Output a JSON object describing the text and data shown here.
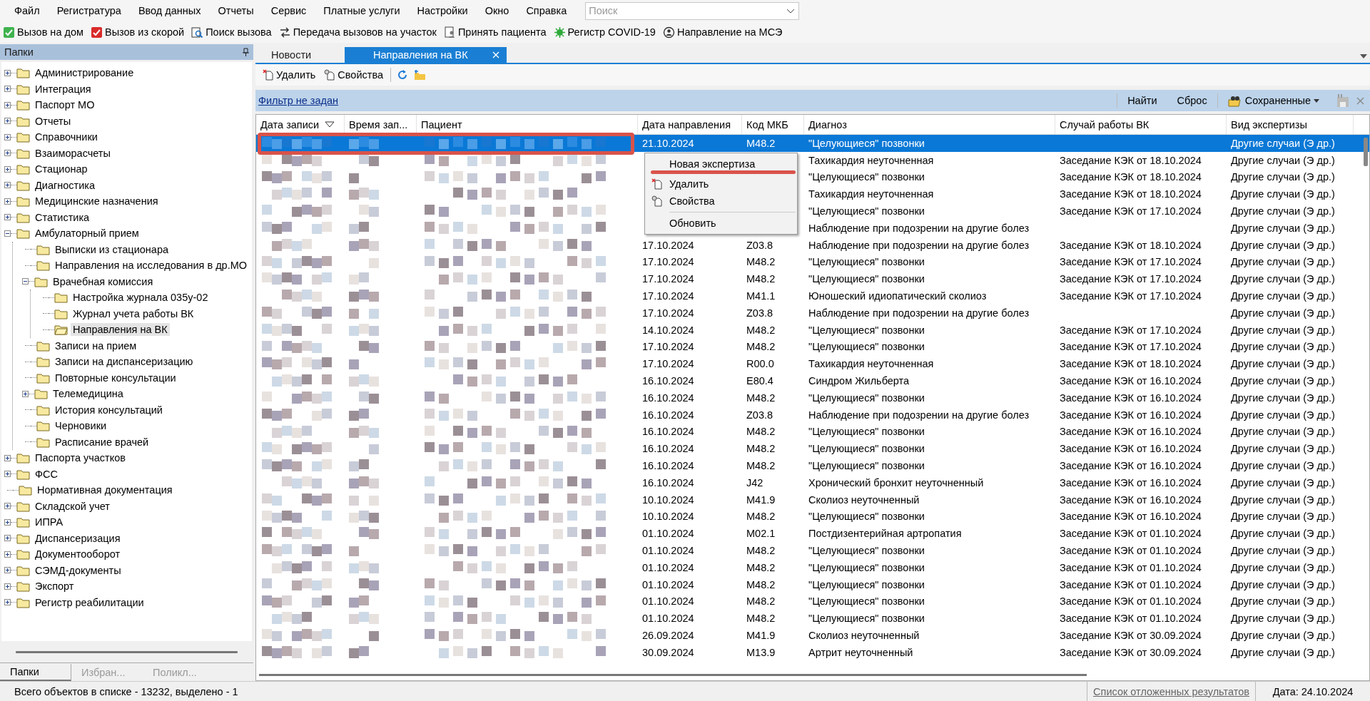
{
  "menu_bar": {
    "items": [
      "Файл",
      "Регистратура",
      "Ввод данных",
      "Отчеты",
      "Сервис",
      "Платные услуги",
      "Настройки",
      "Окно",
      "Справка"
    ],
    "search": {
      "placeholder": "Поиск"
    }
  },
  "toolbar": [
    "Вызов на дом",
    "Вызов из скорой",
    "Поиск вызова",
    "Передача вызовов на участок",
    "Принять пациента",
    "Регистр COVID-19",
    "Направление на МСЭ"
  ],
  "sidebar": {
    "title": "Папки",
    "tree": [
      {
        "label": "Администрирование",
        "expanded": false,
        "selected": false
      },
      {
        "label": "Интеграция",
        "expanded": false,
        "selected": false
      },
      {
        "label": "Паспорт МО",
        "expanded": false,
        "selected": false
      },
      {
        "label": "Отчеты",
        "expanded": false,
        "selected": false
      },
      {
        "label": "Справочники",
        "expanded": false,
        "selected": false
      },
      {
        "label": "Взаиморасчеты",
        "expanded": false,
        "selected": false
      },
      {
        "label": "Стационар",
        "expanded": false,
        "selected": false
      },
      {
        "label": "Диагностика",
        "expanded": false,
        "selected": false
      },
      {
        "label": "Медицинские назначения",
        "expanded": false,
        "selected": false
      },
      {
        "label": "Статистика",
        "expanded": false,
        "selected": false
      },
      {
        "label": "Амбулаторный прием",
        "expanded": true,
        "selected": false,
        "children": [
          {
            "label": "Выписки из стационара",
            "selected": false
          },
          {
            "label": "Направления на исследования в др.МО",
            "selected": false
          },
          {
            "label": "Врачебная комиссия",
            "expanded": true,
            "selected": false,
            "children": [
              {
                "label": "Настройка журнала 035у-02",
                "selected": false
              },
              {
                "label": "Журнал учета работы ВК",
                "selected": false
              },
              {
                "label": "Направления на ВК",
                "selected": true
              }
            ]
          },
          {
            "label": "Записи на прием",
            "selected": false
          },
          {
            "label": "Записи на диспансеризацию",
            "selected": false
          },
          {
            "label": "Повторные консультации",
            "selected": false
          },
          {
            "label": "Телемедицина",
            "expanded": false,
            "selected": false
          },
          {
            "label": "История консультаций",
            "selected": false
          },
          {
            "label": "Черновики",
            "selected": false
          },
          {
            "label": "Расписание врачей",
            "selected": false
          }
        ]
      },
      {
        "label": "Паспорта участков",
        "expanded": false,
        "selected": false
      },
      {
        "label": "ФСС",
        "expanded": false,
        "selected": false
      },
      {
        "label": "Нормативная документация",
        "selected": false
      },
      {
        "label": "Складской учет",
        "expanded": false,
        "selected": false
      },
      {
        "label": "ИПРА",
        "expanded": false,
        "selected": false
      },
      {
        "label": "Диспансеризация",
        "expanded": false,
        "selected": false
      },
      {
        "label": "Документооборот",
        "expanded": false,
        "selected": false
      },
      {
        "label": "СЭМД-документы",
        "expanded": false,
        "selected": false
      },
      {
        "label": "Экспорт",
        "expanded": false,
        "selected": false
      },
      {
        "label": "Регистр реабилитации",
        "expanded": false,
        "selected": false
      }
    ],
    "tabs": [
      {
        "label": "Папки",
        "selected": true
      },
      {
        "label": "Избран...",
        "selected": false
      },
      {
        "label": "Поликл...",
        "selected": false
      }
    ]
  },
  "tabs": [
    {
      "label": "Новости",
      "selected": false
    },
    {
      "label": "Направления на ВК",
      "selected": true
    }
  ],
  "doc_toolbar": [
    "Удалить",
    "Свойства"
  ],
  "filter": {
    "link": "Фильтр не задан",
    "buttons": [
      "Найти",
      "Сброс"
    ],
    "saved": "Сохраненные"
  },
  "table": {
    "columns": [
      {
        "label": "Дата записи",
        "sorted": true
      },
      {
        "label": "Время зап...",
        "sorted": false
      },
      {
        "label": "Пациент",
        "sorted": false
      },
      {
        "label": "Дата направления",
        "sorted": false
      },
      {
        "label": "Код МКБ",
        "sorted": false
      },
      {
        "label": "Диагноз",
        "sorted": false
      },
      {
        "label": "Случай работы ВК",
        "sorted": false
      },
      {
        "label": "Вид экспертизы",
        "sorted": false
      }
    ],
    "rows": [
      {
        "selected": true,
        "date": "21.10.2024",
        "code": "M48.2",
        "diagnosis": "\"Целующиеся\" позвонки",
        "expertise": "Другие случаи (Э др.)"
      },
      {
        "selected": false,
        "diagnosis": "Тахикардия неуточненная",
        "case": "Заседание КЭК от 18.10.2024",
        "expertise": "Другие случаи (Э др.)"
      },
      {
        "selected": false,
        "diagnosis": "\"Целующиеся\" позвонки",
        "case": "Заседание КЭК от 18.10.2024",
        "expertise": "Другие случаи (Э др.)"
      },
      {
        "selected": false,
        "diagnosis": "Тахикардия неуточненная",
        "case": "Заседание КЭК от 18.10.2024",
        "expertise": "Другие случаи (Э др.)"
      },
      {
        "selected": false,
        "diagnosis": "\"Целующиеся\" позвонки",
        "case": "Заседание КЭК от 17.10.2024",
        "expertise": "Другие случаи (Э др.)"
      },
      {
        "selected": false,
        "diagnosis": "Наблюдение при подозрении на другие болез",
        "expertise": "Другие случаи (Э др.)"
      },
      {
        "selected": false,
        "date": "17.10.2024",
        "code": "Z03.8",
        "diagnosis": "Наблюдение при подозрении на другие болез",
        "case": "Заседание КЭК от 18.10.2024",
        "expertise": "Другие случаи (Э др.)"
      },
      {
        "selected": false,
        "date": "17.10.2024",
        "code": "M48.2",
        "diagnosis": "\"Целующиеся\" позвонки",
        "case": "Заседание КЭК от 17.10.2024",
        "expertise": "Другие случаи (Э др.)"
      },
      {
        "selected": false,
        "date": "17.10.2024",
        "code": "M48.2",
        "diagnosis": "\"Целующиеся\" позвонки",
        "case": "Заседание КЭК от 17.10.2024",
        "expertise": "Другие случаи (Э др.)"
      },
      {
        "selected": false,
        "date": "17.10.2024",
        "code": "M41.1",
        "diagnosis": "Юношеский идиопатический сколиоз",
        "case": "Заседание КЭК от 17.10.2024",
        "expertise": "Другие случаи (Э др.)"
      },
      {
        "selected": false,
        "date": "17.10.2024",
        "code": "Z03.8",
        "diagnosis": "Наблюдение при подозрении на другие болез",
        "expertise": "Другие случаи (Э др.)"
      },
      {
        "selected": false,
        "date": "14.10.2024",
        "code": "M48.2",
        "diagnosis": "\"Целующиеся\" позвонки",
        "case": "Заседание КЭК от 17.10.2024",
        "expertise": "Другие случаи (Э др.)"
      },
      {
        "selected": false,
        "date": "17.10.2024",
        "code": "M48.2",
        "diagnosis": "\"Целующиеся\" позвонки",
        "case": "Заседание КЭК от 17.10.2024",
        "expertise": "Другие случаи (Э др.)"
      },
      {
        "selected": false,
        "date": "17.10.2024",
        "code": "R00.0",
        "diagnosis": "Тахикардия неуточненная",
        "case": "Заседание КЭК от 18.10.2024",
        "expertise": "Другие случаи (Э др.)"
      },
      {
        "selected": false,
        "date": "16.10.2024",
        "code": "E80.4",
        "diagnosis": "Синдром Жильберта",
        "case": "Заседание КЭК от 16.10.2024",
        "expertise": "Другие случаи (Э др.)"
      },
      {
        "selected": false,
        "date": "16.10.2024",
        "code": "M48.2",
        "diagnosis": "\"Целующиеся\" позвонки",
        "case": "Заседание КЭК от 16.10.2024",
        "expertise": "Другие случаи (Э др.)"
      },
      {
        "selected": false,
        "date": "16.10.2024",
        "code": "Z03.8",
        "diagnosis": "Наблюдение при подозрении на другие болез",
        "case": "Заседание КЭК от 16.10.2024",
        "expertise": "Другие случаи (Э др.)"
      },
      {
        "selected": false,
        "date": "16.10.2024",
        "code": "M48.2",
        "diagnosis": "\"Целующиеся\" позвонки",
        "case": "Заседание КЭК от 16.10.2024",
        "expertise": "Другие случаи (Э др.)"
      },
      {
        "selected": false,
        "date": "16.10.2024",
        "code": "M48.2",
        "diagnosis": "\"Целующиеся\" позвонки",
        "case": "Заседание КЭК от 16.10.2024",
        "expertise": "Другие случаи (Э др.)"
      },
      {
        "selected": false,
        "date": "16.10.2024",
        "code": "M48.2",
        "diagnosis": "\"Целующиеся\" позвонки",
        "case": "Заседание КЭК от 16.10.2024",
        "expertise": "Другие случаи (Э др.)"
      },
      {
        "selected": false,
        "date": "16.10.2024",
        "code": "J42",
        "diagnosis": "Хронический бронхит неуточненный",
        "case": "Заседание КЭК от 16.10.2024",
        "expertise": "Другие случаи (Э др.)"
      },
      {
        "selected": false,
        "date": "10.10.2024",
        "code": "M41.9",
        "diagnosis": "Сколиоз неуточненный",
        "case": "Заседание КЭК от 16.10.2024",
        "expertise": "Другие случаи (Э др.)"
      },
      {
        "selected": false,
        "date": "10.10.2024",
        "code": "M48.2",
        "diagnosis": "\"Целующиеся\" позвонки",
        "case": "Заседание КЭК от 16.10.2024",
        "expertise": "Другие случаи (Э др.)"
      },
      {
        "selected": false,
        "date": "01.10.2024",
        "code": "M02.1",
        "diagnosis": "Постдизентерийная артропатия",
        "case": "Заседание КЭК от 01.10.2024",
        "expertise": "Другие случаи (Э др.)"
      },
      {
        "selected": false,
        "date": "01.10.2024",
        "code": "M48.2",
        "diagnosis": "\"Целующиеся\" позвонки",
        "case": "Заседание КЭК от 01.10.2024",
        "expertise": "Другие случаи (Э др.)"
      },
      {
        "selected": false,
        "date": "01.10.2024",
        "code": "M48.2",
        "diagnosis": "\"Целующиеся\" позвонки",
        "case": "Заседание КЭК от 01.10.2024",
        "expertise": "Другие случаи (Э др.)"
      },
      {
        "selected": false,
        "date": "01.10.2024",
        "code": "M48.2",
        "diagnosis": "\"Целующиеся\" позвонки",
        "case": "Заседание КЭК от 01.10.2024",
        "expertise": "Другие случаи (Э др.)"
      },
      {
        "selected": false,
        "date": "01.10.2024",
        "code": "M48.2",
        "diagnosis": "\"Целующиеся\" позвонки",
        "case": "Заседание КЭК от 01.10.2024",
        "expertise": "Другие случаи (Э др.)"
      },
      {
        "selected": false,
        "date": "01.10.2024",
        "code": "M48.2",
        "diagnosis": "\"Целующиеся\" позвонки",
        "case": "Заседание КЭК от 01.10.2024",
        "expertise": "Другие случаи (Э др.)"
      },
      {
        "selected": false,
        "date": "26.09.2024",
        "code": "M41.9",
        "diagnosis": "Сколиоз неуточненный",
        "case": "Заседание КЭК от 30.09.2024",
        "expertise": "Другие случаи (Э др.)"
      },
      {
        "selected": false,
        "date": "30.09.2024",
        "code": "M13.9",
        "diagnosis": "Артрит неуточненный",
        "case": "Заседание КЭК от 30.09.2024",
        "expertise": "Другие случаи (Э др.)"
      }
    ]
  },
  "context_menu": [
    {
      "kind": "item",
      "label": "Новая экспертиза"
    },
    {
      "kind": "item",
      "label": "Удалить"
    },
    {
      "kind": "item",
      "label": "Свойства"
    },
    {
      "kind": "separator"
    },
    {
      "kind": "item",
      "label": "Обновить"
    }
  ],
  "status_bar": {
    "text": "Всего объектов в списке - 13232, выделено - 1",
    "link": "Список отложенных результатов",
    "date": "Дата: 24.10.2024"
  }
}
